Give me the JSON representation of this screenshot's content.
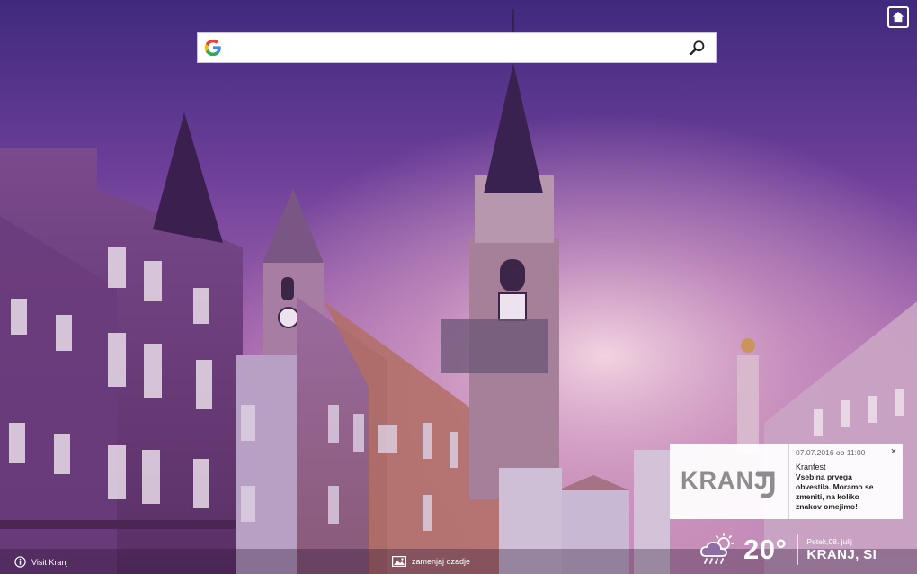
{
  "search": {
    "placeholder": "",
    "logo_icon": "google-g-icon",
    "button_icon": "magnifier-icon"
  },
  "home_button": {
    "icon": "home-icon"
  },
  "notification": {
    "logo_text": "KRANJ",
    "date": "07.07.2016 ob 11:00",
    "title": "Kranfest",
    "text": "Vsebina prvega obvestila. Moramo se zmeniti, na koliko znakov omejimo!",
    "close": "×"
  },
  "weather": {
    "icon": "rain-sun-cloud-icon",
    "temperature": "20°",
    "date": "Petek,08. julij",
    "city": "KRANJ, SI"
  },
  "footer": {
    "visit_label": "Visit Kranj",
    "visit_icon": "info-icon",
    "wallpaper_label": "zamenjaj ozadje",
    "wallpaper_icon": "image-icon"
  },
  "colors": {
    "sky_top": "#4a2a86",
    "sky_mid": "#8b4ca6",
    "haze": "#d8a9c8",
    "building": "#6a3f78"
  }
}
